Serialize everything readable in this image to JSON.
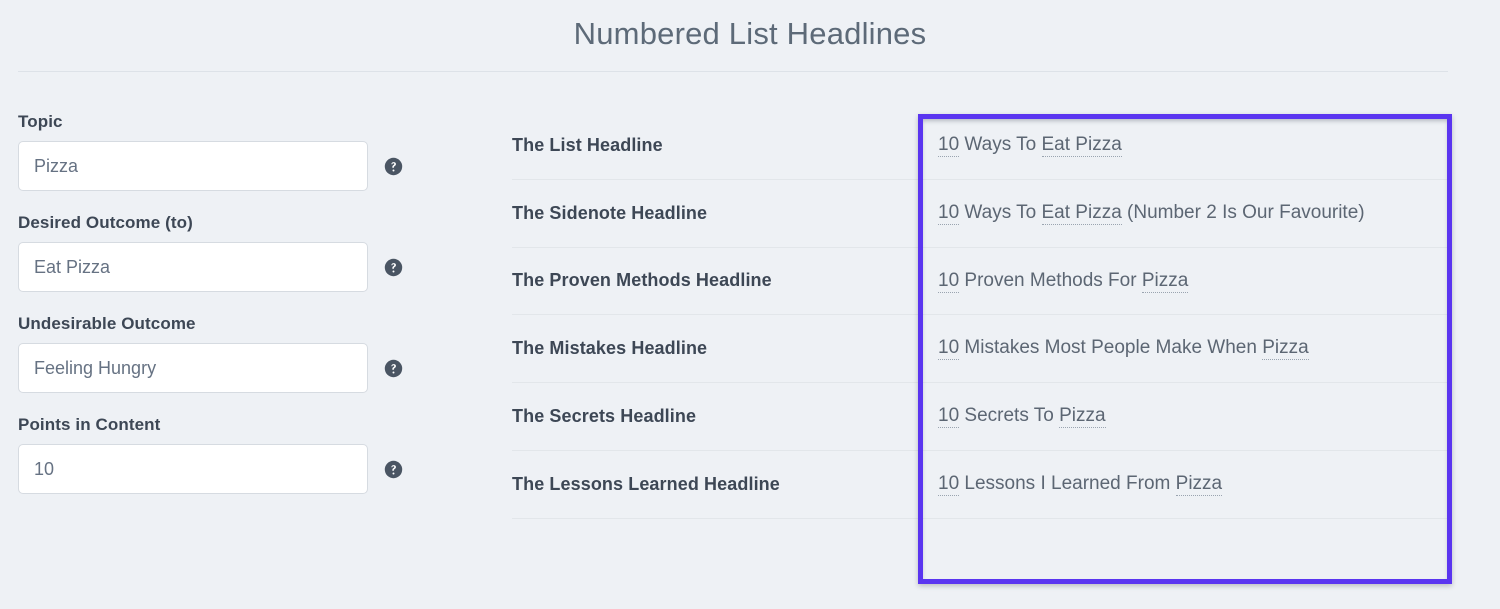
{
  "header": {
    "title": "Numbered List Headlines"
  },
  "form": {
    "help_icon": "help-circle-icon",
    "fields": [
      {
        "label": "Topic",
        "value": "Pizza",
        "placeholder": "Topic"
      },
      {
        "label": "Desired Outcome (to)",
        "value": "Eat Pizza",
        "placeholder": "Desired Outcome (to)"
      },
      {
        "label": "Undesirable Outcome",
        "value": "Feeling Hungry",
        "placeholder": "Undesirable Outcome"
      },
      {
        "label": "Points in Content",
        "value": "10",
        "placeholder": "Points in Content"
      }
    ]
  },
  "results": {
    "rows": [
      {
        "label": "The List Headline",
        "parts": [
          {
            "text": "10",
            "spellcheck": true
          },
          {
            "text": " Ways To ",
            "spellcheck": false
          },
          {
            "text": "Eat Pizza",
            "spellcheck": true
          }
        ]
      },
      {
        "label": "The Sidenote Headline",
        "parts": [
          {
            "text": "10",
            "spellcheck": true
          },
          {
            "text": " Ways To ",
            "spellcheck": false
          },
          {
            "text": "Eat Pizza",
            "spellcheck": true
          },
          {
            "text": " (Number 2 Is Our Favourite)",
            "spellcheck": false
          }
        ]
      },
      {
        "label": "The Proven Methods Headline",
        "parts": [
          {
            "text": "10",
            "spellcheck": true
          },
          {
            "text": " Proven Methods For ",
            "spellcheck": false
          },
          {
            "text": "Pizza",
            "spellcheck": true
          }
        ]
      },
      {
        "label": "The Mistakes Headline",
        "parts": [
          {
            "text": "10",
            "spellcheck": true
          },
          {
            "text": " Mistakes Most People Make When ",
            "spellcheck": false
          },
          {
            "text": "Pizza",
            "spellcheck": true
          }
        ]
      },
      {
        "label": "The Secrets Headline",
        "parts": [
          {
            "text": "10",
            "spellcheck": true
          },
          {
            "text": " Secrets To ",
            "spellcheck": false
          },
          {
            "text": "Pizza",
            "spellcheck": true
          }
        ]
      },
      {
        "label": "The Lessons Learned Headline",
        "parts": [
          {
            "text": "10",
            "spellcheck": true
          },
          {
            "text": " Lessons I Learned From ",
            "spellcheck": false
          },
          {
            "text": "Pizza",
            "spellcheck": true
          }
        ]
      }
    ]
  },
  "highlight": {
    "name": "results-column-highlight",
    "color": "#5a35f0"
  },
  "colors": {
    "background": "#eef1f5",
    "label_text": "#3d4755",
    "value_text": "#5c6673",
    "title_text": "#5d6a78",
    "input_border": "#d6dbe1",
    "row_divider": "#e2e6ea",
    "accent": "#5a35f0"
  }
}
